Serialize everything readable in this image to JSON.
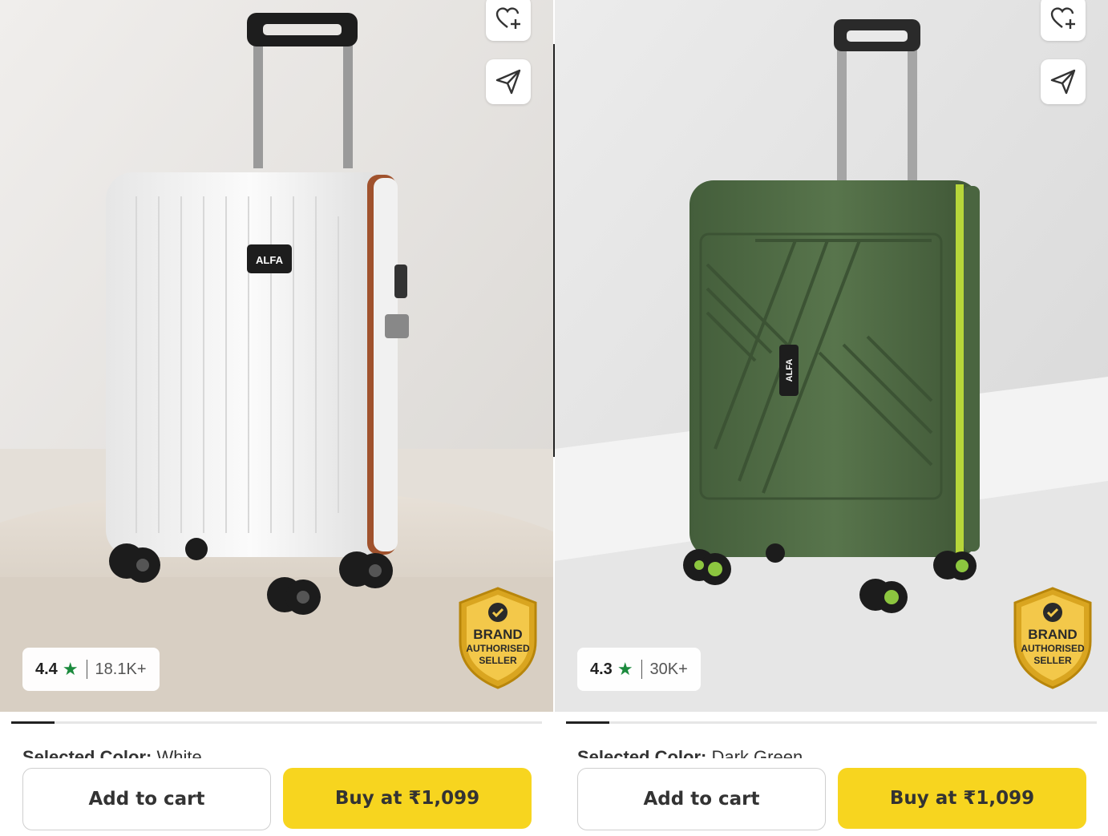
{
  "products": [
    {
      "rating": "4.4",
      "rating_count": "18.1K+",
      "brand_logo": "ALFA",
      "badge": {
        "line1": "BRAND",
        "line2": "AUTHORISED",
        "line3": "SELLER"
      },
      "selected_color_label": "Selected Color:",
      "selected_color_value": "White",
      "add_to_cart": "Add to cart",
      "buy_label": "Buy at ₹1,099",
      "image_carousel_position": 0.08,
      "colors": {
        "body": "#f4f4f4",
        "zipper": "#a0522d",
        "wheel_hub": "#2a2a2a"
      }
    },
    {
      "rating": "4.3",
      "rating_count": "30K+",
      "brand_logo": "ALFA",
      "badge": {
        "line1": "BRAND",
        "line2": "AUTHORISED",
        "line3": "SELLER"
      },
      "selected_color_label": "Selected Color:",
      "selected_color_value": "Dark Green",
      "add_to_cart": "Add to cart",
      "buy_label": "Buy at ₹1,099",
      "image_carousel_position": 0.08,
      "colors": {
        "body": "#4f6a44",
        "zipper": "#b7d63a",
        "wheel_hub": "#8cc63f"
      }
    }
  ],
  "icons": [
    "heart-plus-icon",
    "share-icon",
    "star-icon",
    "verified-check-icon"
  ],
  "colors": {
    "buy_button": "#f7d51f",
    "rating_star": "#1b8a3d",
    "badge_gold": "#d9a520"
  }
}
